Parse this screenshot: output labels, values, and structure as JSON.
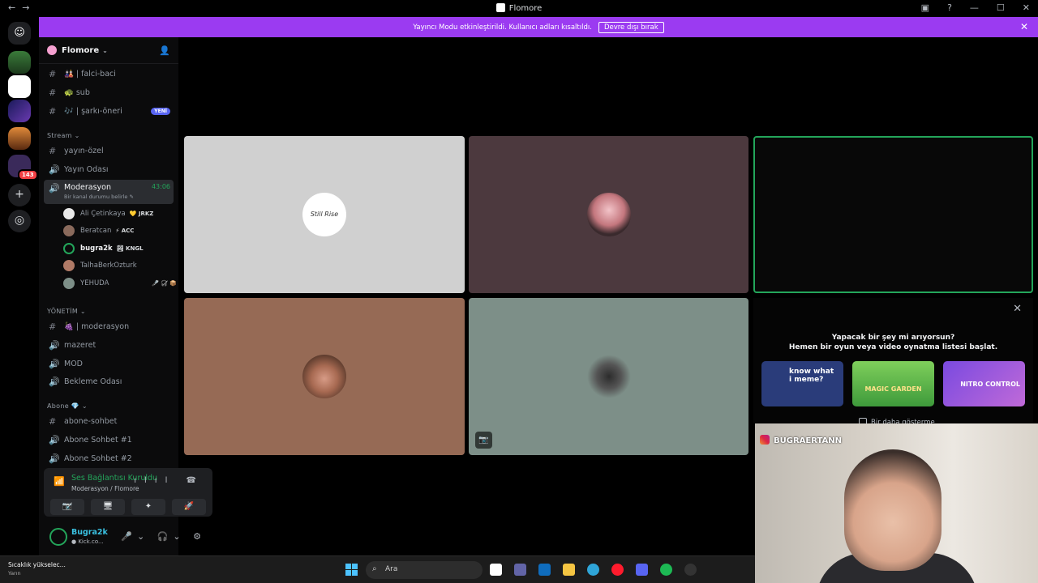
{
  "titlebar": {
    "title": "Flomore",
    "back": "←",
    "forward": "→",
    "minimize": "—",
    "maximize": "☐",
    "close": "✕"
  },
  "banner": {
    "message": "Yayıncı Modu etkinleştirildi. Kullanıcı adları kısaltıldı.",
    "button": "Devre dışı bırak",
    "close": "✕"
  },
  "rail": {
    "badge": "143",
    "add": "+",
    "discover": "◎"
  },
  "server": {
    "name": "Flomore",
    "chevron": "⌄",
    "invite_icon": "👤"
  },
  "channels_top": [
    {
      "icon": "#",
      "label": "🎎 | falci-baci"
    },
    {
      "icon": "#",
      "label": "🐢 sub"
    },
    {
      "icon": "#",
      "label": "🎶 | şarkı-öneri",
      "badge": "YENİ"
    }
  ],
  "category_stream": "Stream ⌄",
  "channels_stream": [
    {
      "icon": "#",
      "label": "yayın-özel"
    },
    {
      "icon": "🔊",
      "label": "Yayın Odası"
    }
  ],
  "active_channel": {
    "label": "Moderasyon",
    "timer": "43:06",
    "status": "Bir kanal durumu belirle ✎"
  },
  "voice_users": [
    {
      "name": "Ali Çetinkaya",
      "tag": "💛 JRKZ",
      "color": "#e9e9e9"
    },
    {
      "name": "Beratcan",
      "tag": "⚡ ACC",
      "color": "#8a6a5c"
    },
    {
      "name": "bugra2k",
      "tag": "🏞 KNGL",
      "color": "#0b0b0c"
    },
    {
      "name": "TalhaBerkOzturk",
      "tag": "",
      "color": "#b07a66"
    },
    {
      "name": "YEHUDA",
      "tag": "🎤̸ 🎧̸ 📦",
      "color": "#7d8f88"
    }
  ],
  "category_yonetim": "YÖNETİM ⌄",
  "channels_yonetim": [
    {
      "icon": "#",
      "label": "🍇 | moderasyon"
    },
    {
      "icon": "🔊",
      "label": "mazeret"
    },
    {
      "icon": "🔊",
      "label": "MOD"
    },
    {
      "icon": "🔊",
      "label": "Bekleme Odası"
    }
  ],
  "category_abone": "Abone 💎 ⌄",
  "channels_abone": [
    {
      "icon": "#",
      "label": "abone-sohbet"
    },
    {
      "icon": "🔊",
      "label": "Abone Sohbet #1"
    },
    {
      "icon": "🔊",
      "label": "Abone Sohbet #2"
    }
  ],
  "voice_panel": {
    "status": "Ses Bağlantısı Kuruldu",
    "location": "Moderasyon / Flomore",
    "signal": "📶",
    "tools": "ılıl ☎",
    "buttons": [
      "📷̸",
      "🖥",
      "✦",
      "🚀"
    ]
  },
  "user_panel": {
    "name": "Bugra2k",
    "status": "● Kick.co...",
    "controls": "🎤⌄ 🎧⌄ ⚙"
  },
  "tiles": {
    "t1_text": "Still Rise",
    "t5_cam": "📷"
  },
  "activity": {
    "close": "✕",
    "line1": "Yapacak bir şey mi arıyorsun?",
    "line2": "Hemen bir oyun veya video oynatma listesi başlat.",
    "card1": "know what i meme?",
    "card2": "MAGIC GARDEN",
    "card3": "NITRO CONTROL",
    "checkbox": "Bir daha gösterme"
  },
  "webcam": {
    "handle": "BUGRAERTANN"
  },
  "taskbar": {
    "weather": "Sıcaklık yükselec...",
    "weather_sub": "Yarın",
    "search": "Ara",
    "search_icon": "⌕"
  }
}
